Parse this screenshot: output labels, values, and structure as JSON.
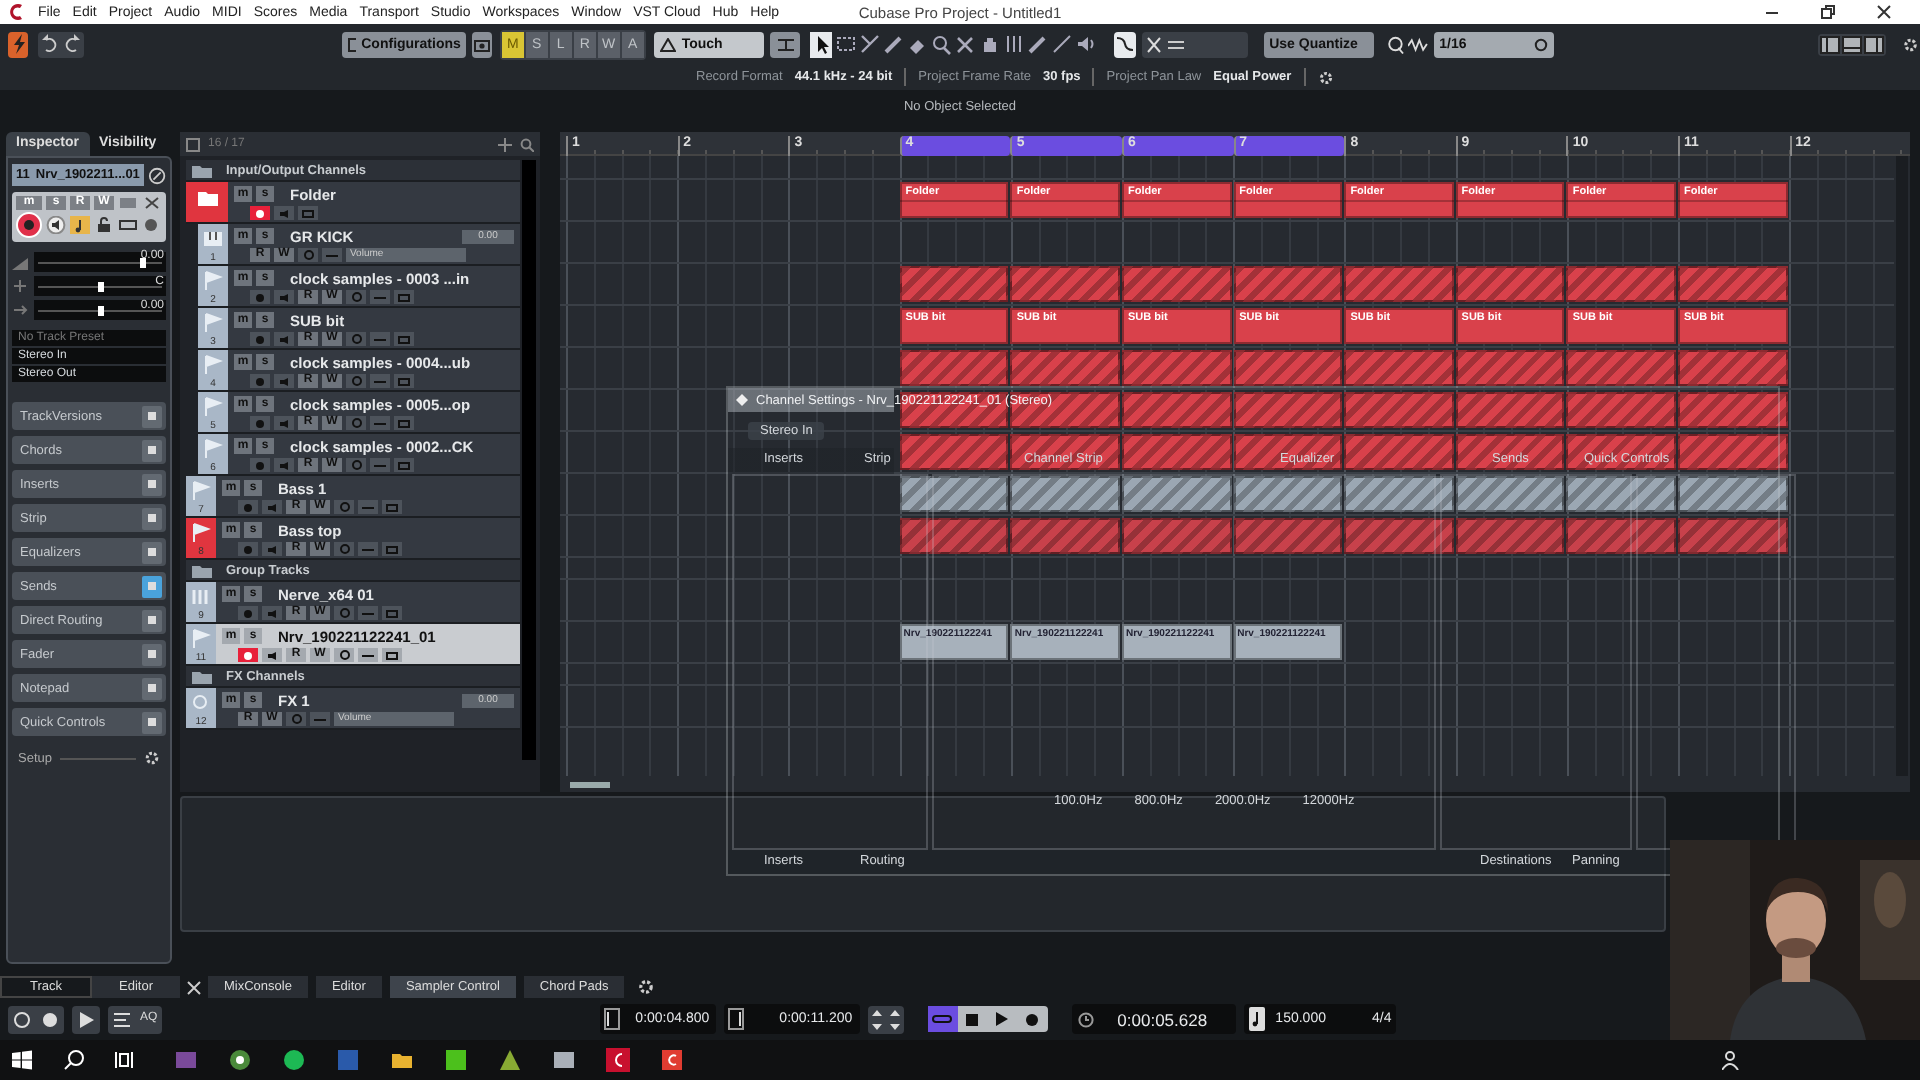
{
  "window": {
    "title": "Cubase Pro Project - Untitled1"
  },
  "menu": [
    "File",
    "Edit",
    "Project",
    "Audio",
    "MIDI",
    "Scores",
    "Media",
    "Transport",
    "Studio",
    "Workspaces",
    "Window",
    "VST Cloud",
    "Hub",
    "Help"
  ],
  "toolbar": {
    "configurations": "Configurations",
    "automation": [
      {
        "label": "M",
        "selected": true
      },
      {
        "label": "S",
        "selected": false
      },
      {
        "label": "L",
        "selected": false
      },
      {
        "label": "R",
        "selected": false
      },
      {
        "label": "W",
        "selected": false
      },
      {
        "label": "A",
        "selected": false
      }
    ],
    "automation_mode": "Touch",
    "tools": [
      {
        "kind": "arrow",
        "selected": true
      },
      {
        "kind": "range",
        "selected": false
      },
      {
        "kind": "split",
        "selected": false
      },
      {
        "kind": "pencil",
        "selected": false
      },
      {
        "kind": "eraser",
        "selected": false
      },
      {
        "kind": "zoom",
        "selected": false
      },
      {
        "kind": "mute",
        "selected": false
      },
      {
        "kind": "hand",
        "selected": false
      },
      {
        "kind": "warp",
        "selected": false
      },
      {
        "kind": "pencil",
        "selected": false
      },
      {
        "kind": "line",
        "selected": false
      },
      {
        "kind": "speaker",
        "selected": false
      }
    ],
    "quantize_mode": "Use Quantize",
    "quantize": "1/16"
  },
  "project_info": [
    {
      "label": "Record Format",
      "value": "44.1 kHz - 24 bit"
    },
    {
      "label": "Project Frame Rate",
      "value": "30 fps"
    },
    {
      "label": "Project Pan Law",
      "value": "Equal Power"
    }
  ],
  "info_line": "No Object Selected",
  "inspector": {
    "tabs": [
      {
        "label": "Inspector",
        "selected": true
      },
      {
        "label": "Visibility",
        "selected": false
      }
    ],
    "track_number": "11",
    "track_name": "Nrv_1902211...01",
    "buttons": [
      "m",
      "s",
      "R",
      "W"
    ],
    "armed": true,
    "faders": [
      {
        "value": "0.00",
        "level": 0.82
      },
      {
        "value": "C",
        "level": 0.5
      },
      {
        "value": "0.00",
        "level": 0.5
      }
    ],
    "preset": "No Track Preset",
    "input": "Stereo In",
    "output": "Stereo Out",
    "sections": [
      {
        "label": "TrackVersions",
        "on": false
      },
      {
        "label": "Chords",
        "on": false
      },
      {
        "label": "Inserts",
        "on": false
      },
      {
        "label": "Strip",
        "on": false
      },
      {
        "label": "Equalizers",
        "on": false
      },
      {
        "label": "Sends",
        "on": true
      },
      {
        "label": "Direct Routing",
        "on": false
      },
      {
        "label": "Fader",
        "on": false
      },
      {
        "label": "Notepad",
        "on": false
      },
      {
        "label": "Quick Controls",
        "on": false
      }
    ],
    "setup": "Setup"
  },
  "track_list": {
    "count": "16 / 17",
    "tracks": [
      {
        "kind": "header",
        "name": "Input/Output Channels"
      },
      {
        "kind": "folder",
        "name": "Folder",
        "color": "#e0353f",
        "selected": false,
        "armed": true,
        "mute": "m",
        "solo": "s",
        "events": [
          {
            "label": "Folder",
            "color": "#d9414b"
          },
          {
            "label": "Folder",
            "color": "#d9414b"
          },
          {
            "label": "Folder",
            "color": "#d9414b"
          },
          {
            "label": "Folder",
            "color": "#d9414b"
          },
          {
            "label": "Folder",
            "color": "#d9414b"
          },
          {
            "label": "Folder",
            "color": "#d9414b"
          },
          {
            "label": "Folder",
            "color": "#d9414b"
          },
          {
            "label": "Folder",
            "color": "#d9414b"
          }
        ],
        "children": [
          {
            "kind": "instrument",
            "number": "1",
            "name": "GR KICK",
            "color": "#a9b7c7",
            "selected": false,
            "mute": "m",
            "solo": "s",
            "controls": [
              "R",
              "W"
            ],
            "volume": "0.00",
            "volume_label": "Volume"
          },
          {
            "kind": "audio",
            "number": "2",
            "name": "clock samples - 0003 ...in",
            "color": "#a9b7c7",
            "selected": false,
            "armed": false,
            "mute": "m",
            "solo": "s",
            "controls": [
              "R",
              "W"
            ],
            "events": [
              {
                "color": "#d9414b"
              },
              {
                "color": "#d9414b"
              },
              {
                "color": "#d9414b"
              },
              {
                "color": "#d9414b"
              },
              {
                "color": "#d9414b"
              },
              {
                "color": "#d9414b"
              },
              {
                "color": "#d9414b"
              },
              {
                "color": "#d9414b"
              }
            ]
          },
          {
            "kind": "audio",
            "number": "3",
            "name": "SUB bit",
            "color": "#a9b7c7",
            "selected": false,
            "armed": false,
            "mute": "m",
            "solo": "s",
            "controls": [
              "R",
              "W"
            ],
            "events": [
              {
                "label": "SUB bit",
                "color": "#d9414b"
              },
              {
                "label": "SUB bit",
                "color": "#d9414b"
              },
              {
                "label": "SUB bit",
                "color": "#d9414b"
              },
              {
                "label": "SUB bit",
                "color": "#d9414b"
              },
              {
                "label": "SUB bit",
                "color": "#d9414b"
              },
              {
                "label": "SUB bit",
                "color": "#d9414b"
              },
              {
                "label": "SUB bit",
                "color": "#d9414b"
              },
              {
                "label": "SUB bit",
                "color": "#d9414b"
              }
            ]
          },
          {
            "kind": "audio",
            "number": "4",
            "name": "clock samples - 0004...ub",
            "color": "#a9b7c7",
            "selected": false,
            "armed": false,
            "mute": "m",
            "solo": "s",
            "controls": [
              "R",
              "W"
            ],
            "events": [
              {
                "color": "#d9414b"
              },
              {
                "color": "#d9414b"
              },
              {
                "color": "#d9414b"
              },
              {
                "color": "#d9414b"
              },
              {
                "color": "#d9414b"
              },
              {
                "color": "#d9414b"
              },
              {
                "color": "#d9414b"
              },
              {
                "color": "#d9414b"
              }
            ]
          },
          {
            "kind": "audio",
            "number": "5",
            "name": "clock samples - 0005...op",
            "color": "#a9b7c7",
            "selected": false,
            "armed": false,
            "mute": "m",
            "solo": "s",
            "controls": [
              "R",
              "W"
            ],
            "events": [
              {
                "color": "#d9414b"
              },
              {
                "color": "#d9414b"
              },
              {
                "color": "#d9414b"
              },
              {
                "color": "#d9414b"
              },
              {
                "color": "#d9414b"
              },
              {
                "color": "#d9414b"
              },
              {
                "color": "#d9414b"
              },
              {
                "color": "#d9414b"
              }
            ]
          },
          {
            "kind": "audio",
            "number": "6",
            "name": "clock samples - 0002...CK",
            "color": "#a9b7c7",
            "selected": false,
            "armed": false,
            "mute": "m",
            "solo": "s",
            "controls": [
              "R",
              "W"
            ],
            "events": [
              {
                "color": "#d9414b"
              },
              {
                "color": "#d9414b"
              },
              {
                "color": "#d9414b"
              },
              {
                "color": "#d9414b"
              },
              {
                "color": "#d9414b"
              },
              {
                "color": "#d9414b"
              },
              {
                "color": "#d9414b"
              },
              {
                "color": "#d9414b"
              }
            ]
          }
        ]
      },
      {
        "kind": "audio",
        "number": "7",
        "name": "Bass 1",
        "color": "#a9b7c7",
        "selected": false,
        "armed": false,
        "mute": "m",
        "solo": "s",
        "controls": [
          "R",
          "W"
        ],
        "events": [
          {
            "color": "#9ba7b3"
          },
          {
            "color": "#9ba7b3"
          },
          {
            "color": "#9ba7b3"
          },
          {
            "color": "#9ba7b3"
          },
          {
            "color": "#9ba7b3"
          },
          {
            "color": "#9ba7b3"
          },
          {
            "color": "#9ba7b3"
          },
          {
            "color": "#9ba7b3"
          }
        ]
      },
      {
        "kind": "audio",
        "number": "8",
        "name": "Bass top",
        "color": "#e0353f",
        "selected": false,
        "armed": false,
        "mute": "m",
        "solo": "s",
        "controls": [
          "R",
          "W"
        ],
        "events": [
          {
            "color": "#c8414b"
          },
          {
            "color": "#c8414b"
          },
          {
            "color": "#c8414b"
          },
          {
            "color": "#c8414b"
          },
          {
            "color": "#c8414b"
          },
          {
            "color": "#c8414b"
          },
          {
            "color": "#c8414b"
          },
          {
            "color": "#c8414b"
          }
        ]
      },
      {
        "kind": "header",
        "name": "Group Tracks"
      },
      {
        "kind": "group",
        "number": "9",
        "name": "Nerve_x64 01",
        "color": "#a9b7c7",
        "selected": false,
        "armed": false,
        "mute": "m",
        "solo": "s",
        "controls": [
          "R",
          "W"
        ]
      },
      {
        "kind": "audio",
        "number": "11",
        "name": "Nrv_190221122241_01",
        "color": "#a9b7c7",
        "selected": true,
        "armed": true,
        "mute": "m",
        "solo": "s",
        "controls": [
          "R",
          "W"
        ],
        "events": [
          {
            "label": "Nrv_190221122241",
            "color": "#a7b1bb"
          },
          {
            "label": "Nrv_190221122241",
            "color": "#a7b1bb"
          },
          {
            "label": "Nrv_190221122241",
            "color": "#a7b1bb"
          },
          {
            "label": "Nrv_190221122241",
            "color": "#a7b1bb"
          }
        ]
      },
      {
        "kind": "header",
        "name": "FX Channels"
      },
      {
        "kind": "fx",
        "number": "12",
        "name": "FX 1",
        "color": "#a9b7c7",
        "selected": false,
        "mute": "m",
        "solo": "s",
        "controls": [
          "R",
          "W"
        ],
        "volume": "0.00",
        "volume_label": "Volume"
      }
    ]
  },
  "arranger": {
    "ruler": [
      {
        "label": "1",
        "in_cycle": false
      },
      {
        "label": "2",
        "in_cycle": false
      },
      {
        "label": "3",
        "in_cycle": false
      },
      {
        "label": "4",
        "in_cycle": true
      },
      {
        "label": "5",
        "in_cycle": true
      },
      {
        "label": "6",
        "in_cycle": true
      },
      {
        "label": "7",
        "in_cycle": true
      },
      {
        "label": "8",
        "in_cycle": false
      },
      {
        "label": "9",
        "in_cycle": false
      },
      {
        "label": "10",
        "in_cycle": false
      },
      {
        "label": "11",
        "in_cycle": false
      },
      {
        "label": "12",
        "in_cycle": false
      }
    ]
  },
  "channel_settings": {
    "title": "Channel Settings - Nrv_190221122241_01 (Stereo)",
    "input": "Stereo In",
    "tabs": [
      "Inserts",
      "Strip",
      "Channel Strip",
      "Equalizer",
      "Sends",
      "Quick Controls"
    ],
    "eq_frequencies": [
      "100.0Hz",
      "800.0Hz",
      "2000.0Hz",
      "12000Hz"
    ],
    "bottom_tabs": [
      "Inserts",
      "Routing",
      "Destinations",
      "Panning"
    ]
  },
  "left_zone_tabs": [
    {
      "label": "Track",
      "selected": true
    },
    {
      "label": "Editor",
      "selected": false
    }
  ],
  "zone_tabs": [
    {
      "label": "MixConsole",
      "selected": false
    },
    {
      "label": "Editor",
      "selected": false
    },
    {
      "label": "Sampler Control",
      "selected": true
    },
    {
      "label": "Chord Pads",
      "selected": false
    }
  ],
  "transport": {
    "auto_quantize": "AQ",
    "left_locator": "0:00:04.800",
    "right_locator": "0:00:11.200",
    "cycle": true,
    "position": "0:00:05.628",
    "tempo": "150.000",
    "signature": "4/4"
  }
}
